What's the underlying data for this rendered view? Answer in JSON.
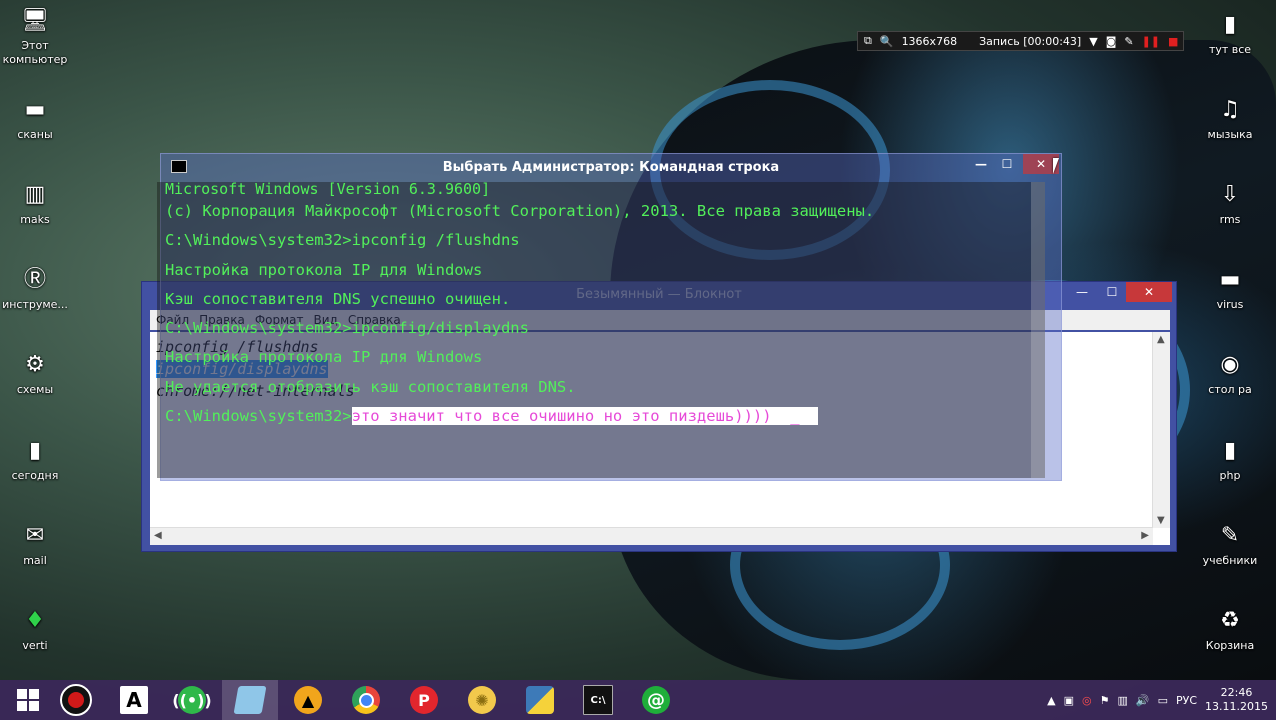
{
  "recorder": {
    "resolution": "1366x768",
    "record_label": "Запись [00:00:43]"
  },
  "desktop_left": [
    {
      "label": "Этот компьютер",
      "icon": "computer-icon"
    },
    {
      "label": "сканы",
      "icon": "scanner-icon"
    },
    {
      "label": "maks",
      "icon": "archive-icon"
    },
    {
      "label": "инструме...",
      "icon": "tools-icon"
    },
    {
      "label": "схемы",
      "icon": "robot-icon"
    },
    {
      "label": "сегодня",
      "icon": "book-icon"
    },
    {
      "label": "mail",
      "icon": "mail-icon"
    },
    {
      "label": "verti",
      "icon": "leaf-icon"
    }
  ],
  "desktop_right": [
    {
      "label": "тут все",
      "icon": "folder-icon"
    },
    {
      "label": "мызыка",
      "icon": "music-icon"
    },
    {
      "label": "rms",
      "icon": "download-icon"
    },
    {
      "label": "virus",
      "icon": "drive-icon"
    },
    {
      "label": "стол ра",
      "icon": "mouse-icon"
    },
    {
      "label": "php",
      "icon": "file-icon"
    },
    {
      "label": "учебники",
      "icon": "pen-icon"
    },
    {
      "label": "Корзина",
      "icon": "recycle-bin-icon"
    }
  ],
  "cmd": {
    "title": "Выбрать Администратор: Командная строка",
    "lines": [
      "Microsoft Windows [Version 6.3.9600]",
      "(c) Корпорация Майкрософт (Microsoft Corporation), 2013. Все права защищены.",
      "C:\\Windows\\system32>ipconfig /flushdns",
      "Настройка протокола IP для Windows",
      "Кэш сопоставителя DNS успешно очищен.",
      "C:\\Windows\\system32>ipconfig/displaydns",
      "Настройка протокола IP для Windows",
      "Не удается отобразить кэш сопоставителя DNS."
    ],
    "prompt": "C:\\Windows\\system32>",
    "typed": "это значит что все очишино но это пиздешь))))"
  },
  "notepad": {
    "title": "Безымянный — Блокнот",
    "menu": [
      "Файл",
      "Правка",
      "Формат",
      "Вид",
      "Справка"
    ],
    "text_lines": [
      "ipconfig /flushdns",
      "ipconfig/displaydns",
      "chrome://net-internals"
    ]
  },
  "taskbar": {
    "items": [
      {
        "name": "start-button",
        "icon": "windows-logo-icon"
      },
      {
        "name": "recorder-app",
        "icon": "record-icon",
        "color": "#d11919"
      },
      {
        "name": "font-app",
        "icon": "letter-a-icon",
        "color": "#ffffff"
      },
      {
        "name": "radio-app",
        "icon": "broadcast-icon",
        "color": "#2fb84a"
      },
      {
        "name": "notepad-app",
        "icon": "notepad-icon",
        "color": "#8fc6e8"
      },
      {
        "name": "aimp-app",
        "icon": "triangle-icon",
        "color": "#f1a51c"
      },
      {
        "name": "chrome-app",
        "icon": "chrome-icon",
        "color": "#e8453c"
      },
      {
        "name": "pinterest-app",
        "icon": "p-icon",
        "color": "#e2262d"
      },
      {
        "name": "lemon-app",
        "icon": "citrus-icon",
        "color": "#f2c94c"
      },
      {
        "name": "python-app",
        "icon": "python-icon",
        "color": "#3d7ab8"
      },
      {
        "name": "cmd-app",
        "icon": "console-icon",
        "color": "#111111"
      },
      {
        "name": "mail-agent-app",
        "icon": "at-icon",
        "color": "#1fae3a"
      }
    ],
    "lang": "РУС",
    "time": "22:46",
    "date": "13.11.2015"
  }
}
